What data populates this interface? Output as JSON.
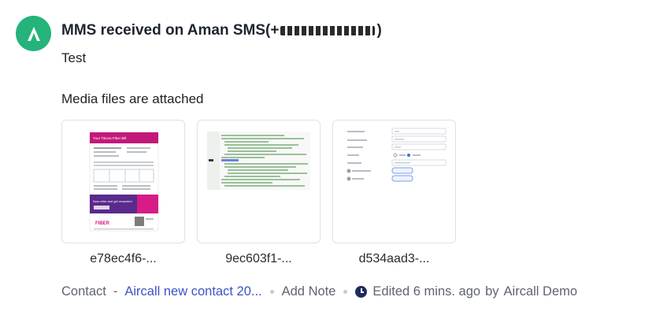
{
  "message": {
    "title_prefix": "MMS received on Aman SMS(+",
    "title_suffix": ")",
    "body": "Test",
    "media_label": "Media files are attached"
  },
  "attachments": [
    {
      "name": "e78ec4f6-..."
    },
    {
      "name": "9ec603f1-..."
    },
    {
      "name": "d534aad3-..."
    }
  ],
  "thumb_text": {
    "bill_header": "Your Tikona Fiber Bill",
    "bill_promo": "Now refer and get rewarded",
    "bill_brand": "FIBER"
  },
  "footer": {
    "contact_label": "Contact",
    "separator": "-",
    "contact_link": "Aircall new contact 20...",
    "add_note": "Add Note",
    "edited": "Edited 6 mins. ago",
    "by": "by",
    "author": "Aircall Demo"
  },
  "colors": {
    "avatar": "#24b37a",
    "link": "#3b55c5",
    "clock": "#1f2b5e"
  },
  "icons": [
    "aircall-logo-icon",
    "clock-icon"
  ]
}
